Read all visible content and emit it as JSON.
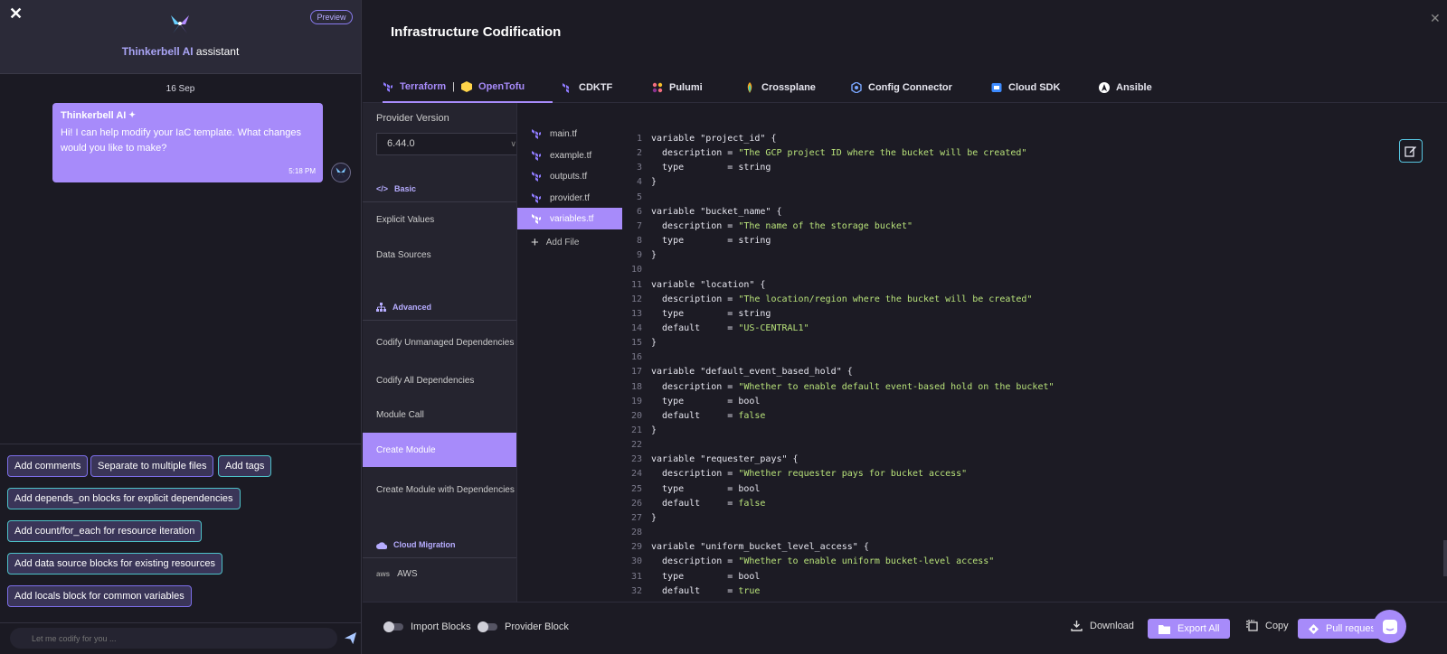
{
  "chat": {
    "title_brand": "Thinkerbell AI",
    "title_rest": " assistant",
    "preview_badge": "Preview",
    "date": "16 Sep",
    "message": {
      "sender": "Thinkerbell AI",
      "text": "Hi! I can help modify your IaC template. What changes would you like to make?",
      "time": "5:18 PM"
    },
    "suggestions": [
      "Add comments",
      "Separate to multiple files",
      "Add tags",
      "Add depends_on blocks for explicit dependencies",
      "Add count/for_each for resource iteration",
      "Add data source blocks for existing resources",
      "Add locals block for common variables"
    ],
    "input_placeholder": "Let me codify for you ..."
  },
  "main": {
    "title": "Infrastructure Codification",
    "tabs": [
      {
        "label": "Terraform",
        "label2": "OpenTofu",
        "icon": "terraform-icon",
        "active": true
      },
      {
        "label": "CDKTF",
        "icon": "cdktf-icon"
      },
      {
        "label": "Pulumi",
        "icon": "pulumi-icon"
      },
      {
        "label": "Crossplane",
        "icon": "crossplane-icon"
      },
      {
        "label": "Config Connector",
        "icon": "config-connector-icon"
      },
      {
        "label": "Cloud SDK",
        "icon": "cloud-sdk-icon"
      },
      {
        "label": "Ansible",
        "icon": "ansible-icon"
      }
    ],
    "tab_separator": "|",
    "provider_version_label": "Provider Version",
    "provider_version_value": "6.44.0",
    "sections": {
      "basic": "Basic",
      "advanced": "Advanced",
      "cloud_migration": "Cloud Migration"
    },
    "nav": {
      "explicit_values": "Explicit Values",
      "data_sources": "Data Sources",
      "codify_unmanaged": "Codify Unmanaged Dependencies",
      "codify_all": "Codify All Dependencies",
      "module_call": "Module Call",
      "create_module": "Create Module",
      "create_module_deps": "Create Module with Dependencies",
      "aws": "AWS"
    },
    "files": [
      "main.tf",
      "example.tf",
      "outputs.tf",
      "provider.tf",
      "variables.tf"
    ],
    "active_file": "variables.tf",
    "add_file": "Add File",
    "code": [
      {
        "n": "1",
        "parts": [
          [
            "kw",
            "variable "
          ],
          [
            "str2",
            "\"project_id\""
          ],
          [
            "pl",
            " {"
          ]
        ]
      },
      {
        "n": "2",
        "parts": [
          [
            "pl",
            "  description = "
          ],
          [
            "str",
            "\"The GCP project ID where the bucket will be created\""
          ]
        ]
      },
      {
        "n": "3",
        "parts": [
          [
            "pl",
            "  type        = string"
          ]
        ]
      },
      {
        "n": "4",
        "parts": [
          [
            "pl",
            "}"
          ]
        ]
      },
      {
        "n": "5",
        "parts": []
      },
      {
        "n": "6",
        "parts": [
          [
            "kw",
            "variable "
          ],
          [
            "str2",
            "\"bucket_name\""
          ],
          [
            "pl",
            " {"
          ]
        ]
      },
      {
        "n": "7",
        "parts": [
          [
            "pl",
            "  description = "
          ],
          [
            "str",
            "\"The name of the storage bucket\""
          ]
        ]
      },
      {
        "n": "8",
        "parts": [
          [
            "pl",
            "  type        = string"
          ]
        ]
      },
      {
        "n": "9",
        "parts": [
          [
            "pl",
            "}"
          ]
        ]
      },
      {
        "n": "10",
        "parts": []
      },
      {
        "n": "11",
        "parts": [
          [
            "kw",
            "variable "
          ],
          [
            "str2",
            "\"location\""
          ],
          [
            "pl",
            " {"
          ]
        ]
      },
      {
        "n": "12",
        "parts": [
          [
            "pl",
            "  description = "
          ],
          [
            "str",
            "\"The location/region where the bucket will be created\""
          ]
        ]
      },
      {
        "n": "13",
        "parts": [
          [
            "pl",
            "  type        = string"
          ]
        ]
      },
      {
        "n": "14",
        "parts": [
          [
            "pl",
            "  default     = "
          ],
          [
            "str",
            "\"US-CENTRAL1\""
          ]
        ]
      },
      {
        "n": "15",
        "parts": [
          [
            "pl",
            "}"
          ]
        ]
      },
      {
        "n": "16",
        "parts": []
      },
      {
        "n": "17",
        "parts": [
          [
            "kw",
            "variable "
          ],
          [
            "str2",
            "\"default_event_based_hold\""
          ],
          [
            "pl",
            " {"
          ]
        ]
      },
      {
        "n": "18",
        "parts": [
          [
            "pl",
            "  description = "
          ],
          [
            "str",
            "\"Whether to enable default event-based hold on the bucket\""
          ]
        ]
      },
      {
        "n": "19",
        "parts": [
          [
            "pl",
            "  type        = bool"
          ]
        ]
      },
      {
        "n": "20",
        "parts": [
          [
            "pl",
            "  default     = "
          ],
          [
            "str",
            "false"
          ]
        ]
      },
      {
        "n": "21",
        "parts": [
          [
            "pl",
            "}"
          ]
        ]
      },
      {
        "n": "22",
        "parts": []
      },
      {
        "n": "23",
        "parts": [
          [
            "kw",
            "variable "
          ],
          [
            "str2",
            "\"requester_pays\""
          ],
          [
            "pl",
            " {"
          ]
        ]
      },
      {
        "n": "24",
        "parts": [
          [
            "pl",
            "  description = "
          ],
          [
            "str",
            "\"Whether requester pays for bucket access\""
          ]
        ]
      },
      {
        "n": "25",
        "parts": [
          [
            "pl",
            "  type        = bool"
          ]
        ]
      },
      {
        "n": "26",
        "parts": [
          [
            "pl",
            "  default     = "
          ],
          [
            "str",
            "false"
          ]
        ]
      },
      {
        "n": "27",
        "parts": [
          [
            "pl",
            "}"
          ]
        ]
      },
      {
        "n": "28",
        "parts": []
      },
      {
        "n": "29",
        "parts": [
          [
            "kw",
            "variable "
          ],
          [
            "str2",
            "\"uniform_bucket_level_access\""
          ],
          [
            "pl",
            " {"
          ]
        ]
      },
      {
        "n": "30",
        "parts": [
          [
            "pl",
            "  description = "
          ],
          [
            "str",
            "\"Whether to enable uniform bucket-level access\""
          ]
        ]
      },
      {
        "n": "31",
        "parts": [
          [
            "pl",
            "  type        = bool"
          ]
        ]
      },
      {
        "n": "32",
        "parts": [
          [
            "pl",
            "  default     = "
          ],
          [
            "str",
            "true"
          ]
        ]
      }
    ],
    "bottom": {
      "import_blocks": "Import Blocks",
      "provider_block": "Provider Block",
      "download": "Download",
      "export_all": "Export All",
      "copy": "Copy",
      "pull_request": "Pull request"
    }
  },
  "colors": {
    "accent": "#a78bfa",
    "string": "#b8e27a",
    "teal": "#4dc1c8"
  }
}
